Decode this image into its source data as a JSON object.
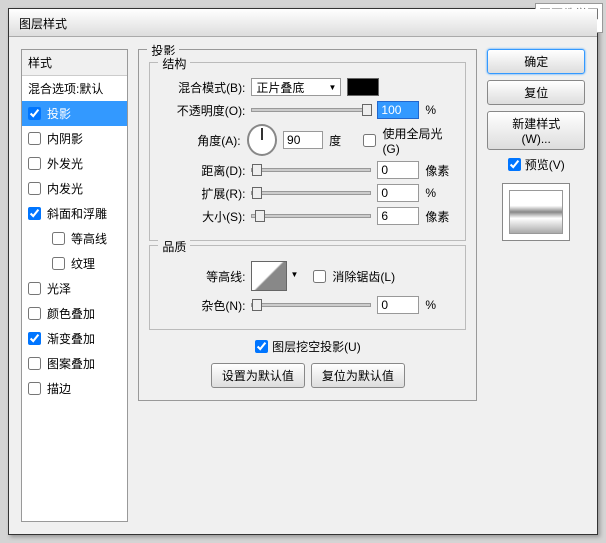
{
  "watermark": {
    "line1": "网页教学网",
    "line2": "www.webjx.com"
  },
  "title": "图层样式",
  "styles": {
    "header": "样式",
    "blend": "混合选项:默认",
    "items": [
      {
        "label": "投影",
        "checked": true,
        "selected": true
      },
      {
        "label": "内阴影",
        "checked": false
      },
      {
        "label": "外发光",
        "checked": false
      },
      {
        "label": "内发光",
        "checked": false
      },
      {
        "label": "斜面和浮雕",
        "checked": true
      },
      {
        "label": "等高线",
        "checked": false,
        "indent": true
      },
      {
        "label": "纹理",
        "checked": false,
        "indent": true
      },
      {
        "label": "光泽",
        "checked": false
      },
      {
        "label": "颜色叠加",
        "checked": false
      },
      {
        "label": "渐变叠加",
        "checked": true
      },
      {
        "label": "图案叠加",
        "checked": false
      },
      {
        "label": "描边",
        "checked": false
      }
    ]
  },
  "panel": {
    "title": "投影",
    "structure": {
      "legend": "结构",
      "blendMode": {
        "label": "混合模式(B):",
        "value": "正片叠底"
      },
      "opacity": {
        "label": "不透明度(O):",
        "value": "100",
        "unit": "%",
        "thumbPos": "110px"
      },
      "angle": {
        "label": "角度(A):",
        "value": "90",
        "unit": "度",
        "global": "使用全局光(G)"
      },
      "distance": {
        "label": "距离(D):",
        "value": "0",
        "unit": "像素",
        "thumbPos": "0px"
      },
      "spread": {
        "label": "扩展(R):",
        "value": "0",
        "unit": "%",
        "thumbPos": "0px"
      },
      "size": {
        "label": "大小(S):",
        "value": "6",
        "unit": "像素",
        "thumbPos": "3px"
      }
    },
    "quality": {
      "legend": "品质",
      "contour": {
        "label": "等高线:",
        "antialias": "消除锯齿(L)"
      },
      "noise": {
        "label": "杂色(N):",
        "value": "0",
        "unit": "%",
        "thumbPos": "0px"
      }
    },
    "knockout": "图层挖空投影(U)",
    "defaults": {
      "set": "设置为默认值",
      "reset": "复位为默认值"
    }
  },
  "buttons": {
    "ok": "确定",
    "cancel": "复位",
    "newStyle": "新建样式(W)...",
    "preview": "预览(V)"
  }
}
